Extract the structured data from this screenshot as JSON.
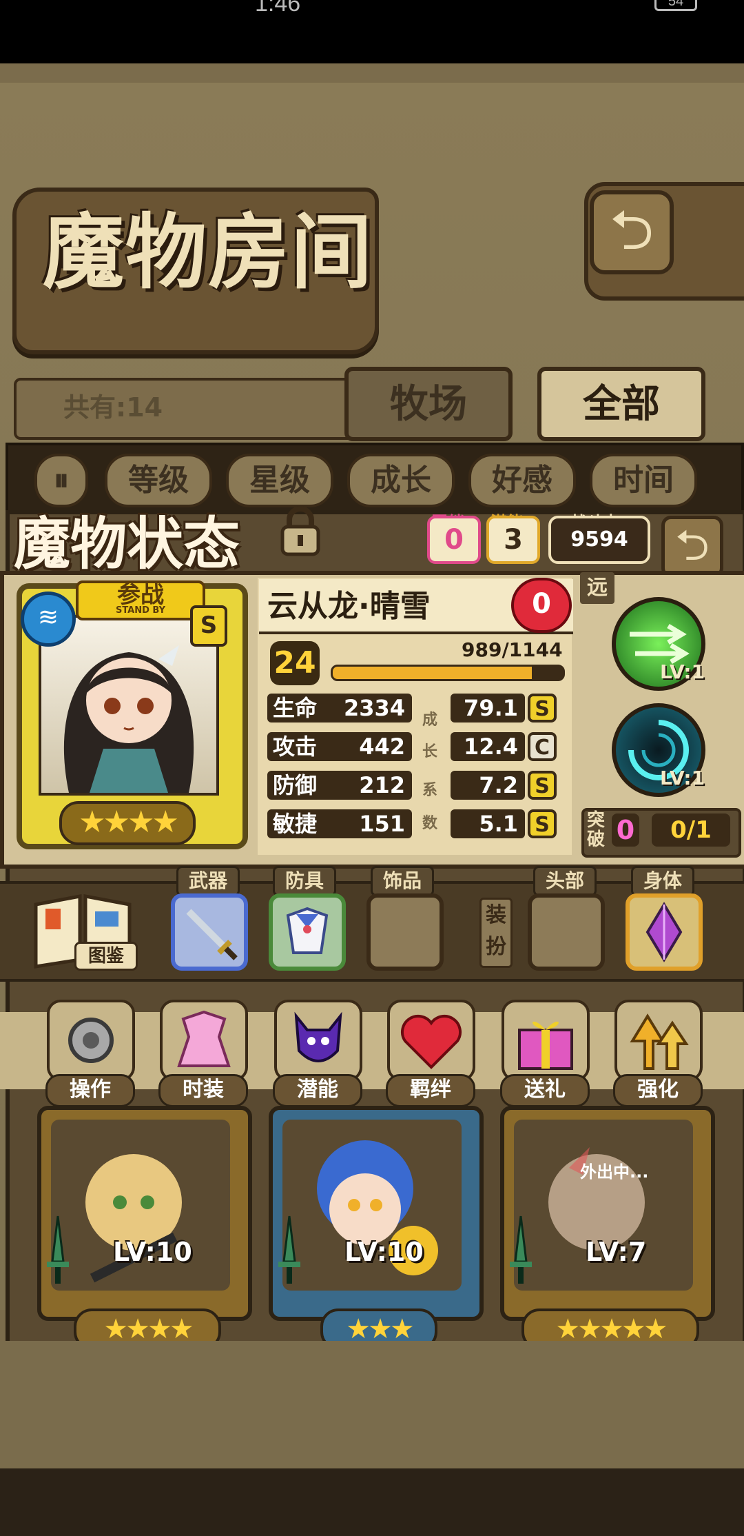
{
  "status_bar": {
    "time": "1:46",
    "battery": "54"
  },
  "room": {
    "title": "魔物房间",
    "back_icon": "return-arrow-icon",
    "total_label": "共有:14",
    "tabs": [
      "牧场",
      "全部"
    ],
    "sort_toggle_icon": "pause-icon",
    "sort_buttons": [
      "等级",
      "星级",
      "成长",
      "好感",
      "时间"
    ]
  },
  "status_panel": {
    "title": "魔物状态",
    "lock_icon": "lock-icon",
    "bond_label": "羁绊",
    "bond_value": "0",
    "potential_label": "潜能",
    "potential_value": "3",
    "power_label": "战斗力",
    "power_value": "9594",
    "close_icon": "return-arrow-icon",
    "standby_label": "参战",
    "standby_sub": "STAND BY",
    "element_icon": "water-icon",
    "rank": "S",
    "star_count": 4,
    "stars_text": "★★★★",
    "monster_name": "云从龙·晴雪",
    "affection": "0",
    "level": "24",
    "exp_text": "989/1144",
    "exp_fraction": 0.865,
    "growth_header": [
      "成",
      "长",
      "系",
      "数"
    ],
    "stats": [
      {
        "name": "生命",
        "value": "2334",
        "growth": "79.1",
        "grade": "S"
      },
      {
        "name": "攻击",
        "value": "442",
        "growth": "12.4",
        "grade": "C"
      },
      {
        "name": "防御",
        "value": "212",
        "growth": "7.2",
        "grade": "S"
      },
      {
        "name": "敏捷",
        "value": "151",
        "growth": "5.1",
        "grade": "S"
      }
    ],
    "range_tag": "远",
    "skills": [
      {
        "icon": "arrow-volley-skill-icon",
        "level": "LV:1"
      },
      {
        "icon": "vortex-skill-icon",
        "level": "LV:1"
      }
    ],
    "breakthrough_label": "突破",
    "breakthrough_count": "0",
    "breakthrough_ratio": "0/1"
  },
  "equipment": {
    "codex_label": "图鉴",
    "slots": [
      {
        "label": "武器",
        "icon": "sword-icon"
      },
      {
        "label": "防具",
        "icon": "sailor-outfit-icon"
      },
      {
        "label": "饰品",
        "icon": ""
      }
    ],
    "dress_label": "装扮",
    "dress_slots": [
      {
        "label": "头部",
        "icon": ""
      },
      {
        "label": "身体",
        "icon": "purple-crystal-icon"
      }
    ]
  },
  "actions": [
    {
      "label": "操作",
      "icon": "gear-icon"
    },
    {
      "label": "时装",
      "icon": "dress-icon"
    },
    {
      "label": "潜能",
      "icon": "shadow-demon-icon"
    },
    {
      "label": "羁绊",
      "icon": "hearts-icon"
    },
    {
      "label": "送礼",
      "icon": "gift-icon"
    },
    {
      "label": "强化",
      "icon": "upgrade-arrows-icon"
    }
  ],
  "monster_cards": [
    {
      "level": "LV:10",
      "stars_text": "★★★★",
      "star_count": 4,
      "frame": "#8a6a2a"
    },
    {
      "level": "LV:10",
      "stars_text": "★★★",
      "star_count": 3,
      "frame": "#3a6a8a"
    },
    {
      "level": "LV:7",
      "stars_text": "★★★★★",
      "star_count": 5,
      "frame": "#8a6a2a",
      "status": "外出中..."
    }
  ],
  "colors": {
    "gold": "#ffd33a",
    "frame": "#3a2a17",
    "parchment": "#d3c39a"
  }
}
